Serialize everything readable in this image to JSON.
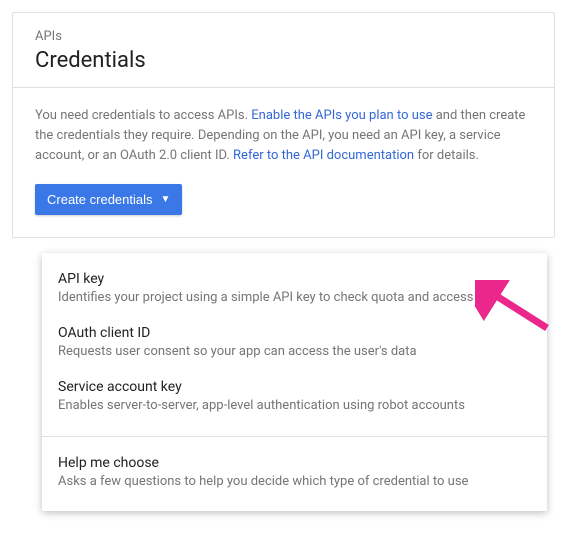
{
  "header": {
    "overline": "APIs",
    "title": "Credentials"
  },
  "description": {
    "text1": "You need credentials to access APIs. ",
    "link1": "Enable the APIs you plan to use",
    "text2": " and then create the credentials they require. Depending on the API, you need an API key, a service account, or an OAuth 2.0 client ID. ",
    "link2": "Refer to the API documentation",
    "text3": " for details."
  },
  "button": {
    "label": "Create credentials"
  },
  "menu": {
    "items": [
      {
        "title": "API key",
        "desc": "Identifies your project using a simple API key to check quota and access"
      },
      {
        "title": "OAuth client ID",
        "desc": "Requests user consent so your app can access the user's data"
      },
      {
        "title": "Service account key",
        "desc": "Enables server-to-server, app-level authentication using robot accounts"
      }
    ],
    "help": {
      "title": "Help me choose",
      "desc": "Asks a few questions to help you decide which type of credential to use"
    }
  }
}
